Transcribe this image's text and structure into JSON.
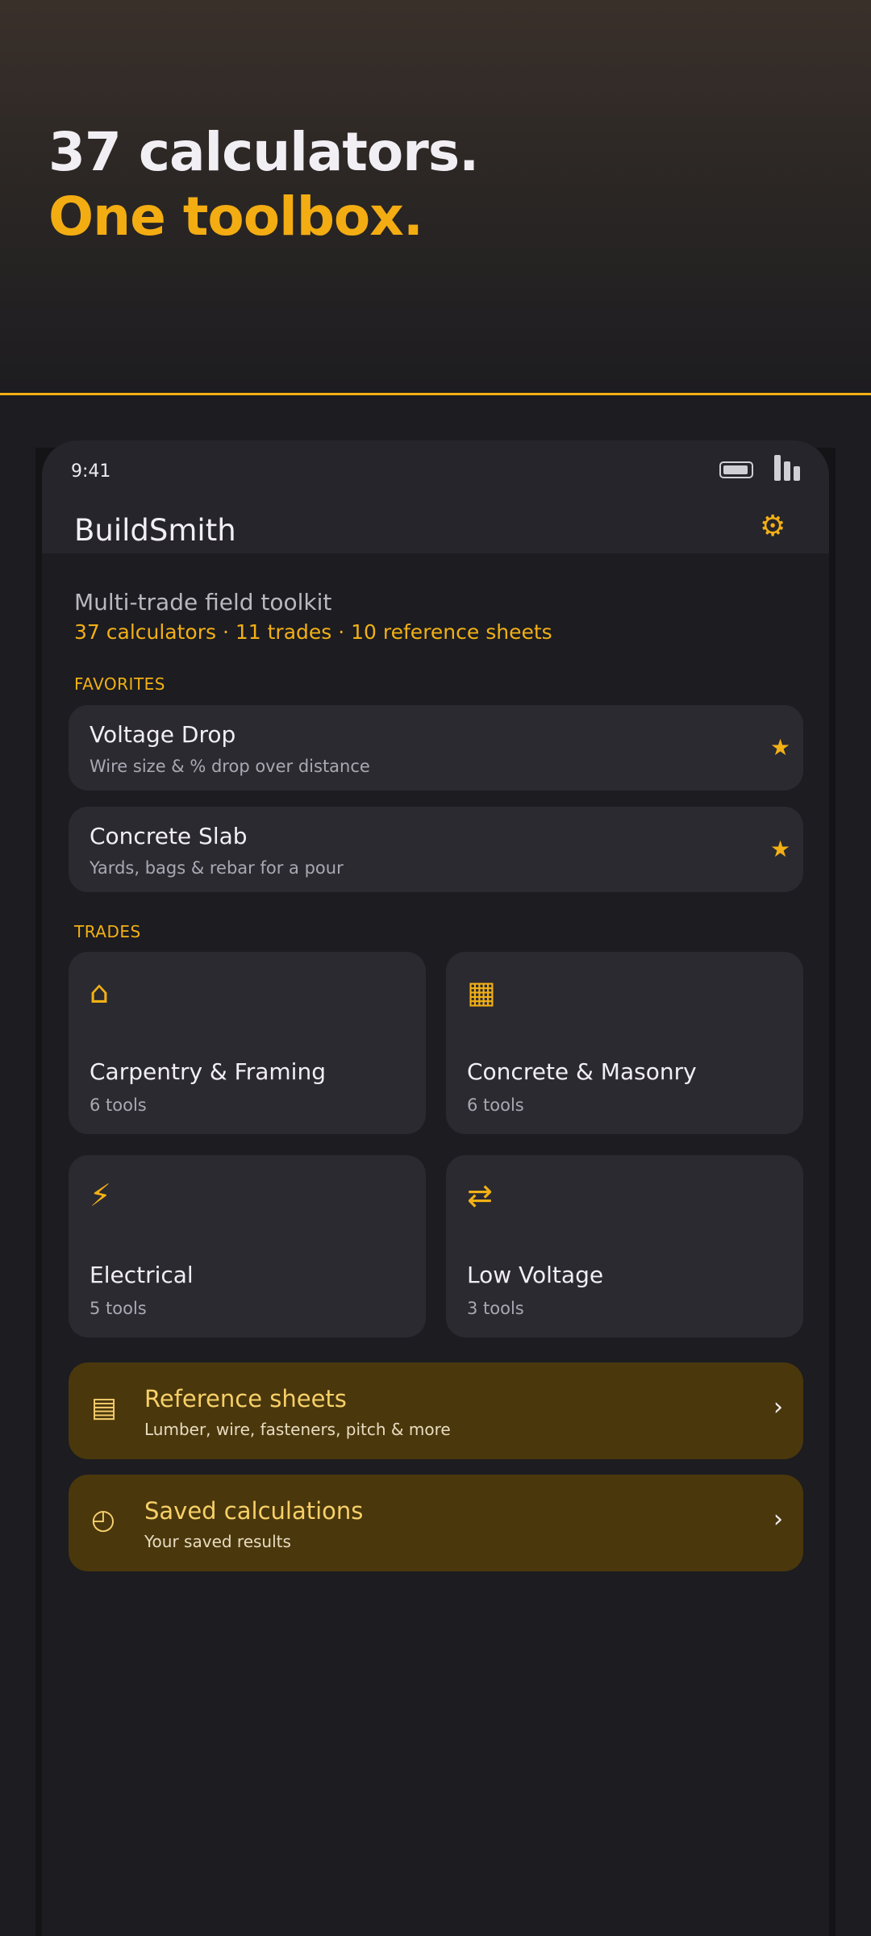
{
  "hero": {
    "line1": "37 calculators.",
    "line2": "One toolbox."
  },
  "statusbar": {
    "time": "9:41"
  },
  "app": {
    "title": "BuildSmith",
    "settings_icon": "⚙"
  },
  "summary": {
    "subtitle": "Multi-trade field toolkit",
    "stats": "37 calculators · 11 trades · 10 reference sheets"
  },
  "favorites": {
    "label": "FAVORITES",
    "items": [
      {
        "title": "Voltage Drop",
        "subtitle": "Wire size & % drop over distance",
        "star": "★"
      },
      {
        "title": "Concrete Slab",
        "subtitle": "Yards, bags & rebar for a pour",
        "star": "★"
      }
    ]
  },
  "trades": {
    "label": "TRADES",
    "items": [
      {
        "icon": "⌂",
        "title": "Carpentry & Framing",
        "count": "6 tools"
      },
      {
        "icon": "▦",
        "title": "Concrete & Masonry",
        "count": "6 tools"
      },
      {
        "icon": "⚡",
        "title": "Electrical",
        "count": "5 tools"
      },
      {
        "icon": "⇄",
        "title": "Low Voltage",
        "count": "3 tools"
      }
    ]
  },
  "links": [
    {
      "icon": "▤",
      "title": "Reference sheets",
      "subtitle": "Lumber, wire, fasteners, pitch & more",
      "chevron": "›"
    },
    {
      "icon": "◴",
      "title": "Saved calculations",
      "subtitle": "Your saved results",
      "chevron": "›"
    }
  ],
  "colors": {
    "accent": "#f2b015",
    "background": "#1c1c21",
    "card": "#2b2a31",
    "link_card": "#4a370c"
  }
}
